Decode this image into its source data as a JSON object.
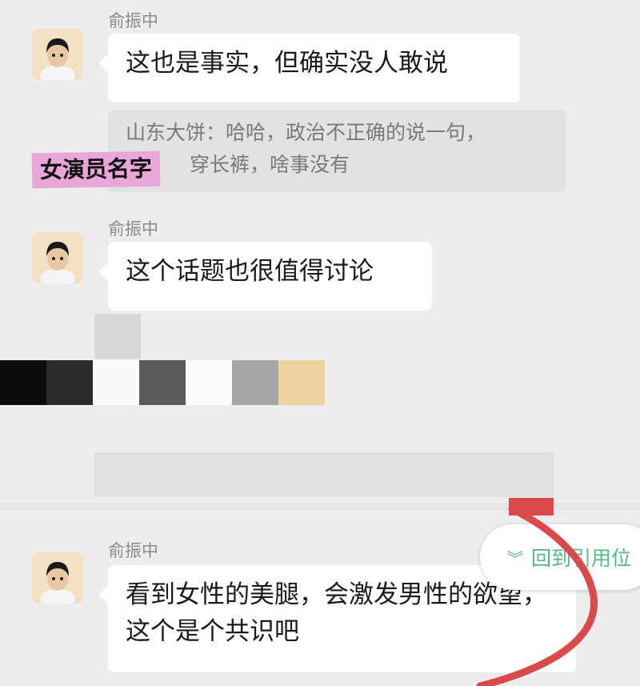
{
  "messages": [
    {
      "sender": "俞振中",
      "text": "这也是事实，但确实没人敢说"
    },
    {
      "sender": "俞振中",
      "text": "这个话题也很值得讨论"
    },
    {
      "sender": "俞振中",
      "text": "看到女性的美腿，会激发男性的欲望，这个是个共识吧"
    }
  ],
  "quote": {
    "line1": "山东大饼：哈哈，政治不正确的说一句，",
    "line2": "穿长裤，啥事没有"
  },
  "redaction_tag": "女演员名字",
  "back_to_quote": {
    "icon": "chevron-double-down-icon",
    "label": "回到引用位"
  },
  "colors": {
    "background": "#ededed",
    "bubble": "#ffffff",
    "quote_bg": "#e2e2e2",
    "tag": "#e9a6d8",
    "accent_green": "#58b885",
    "annotation_red": "#d94a4a"
  }
}
